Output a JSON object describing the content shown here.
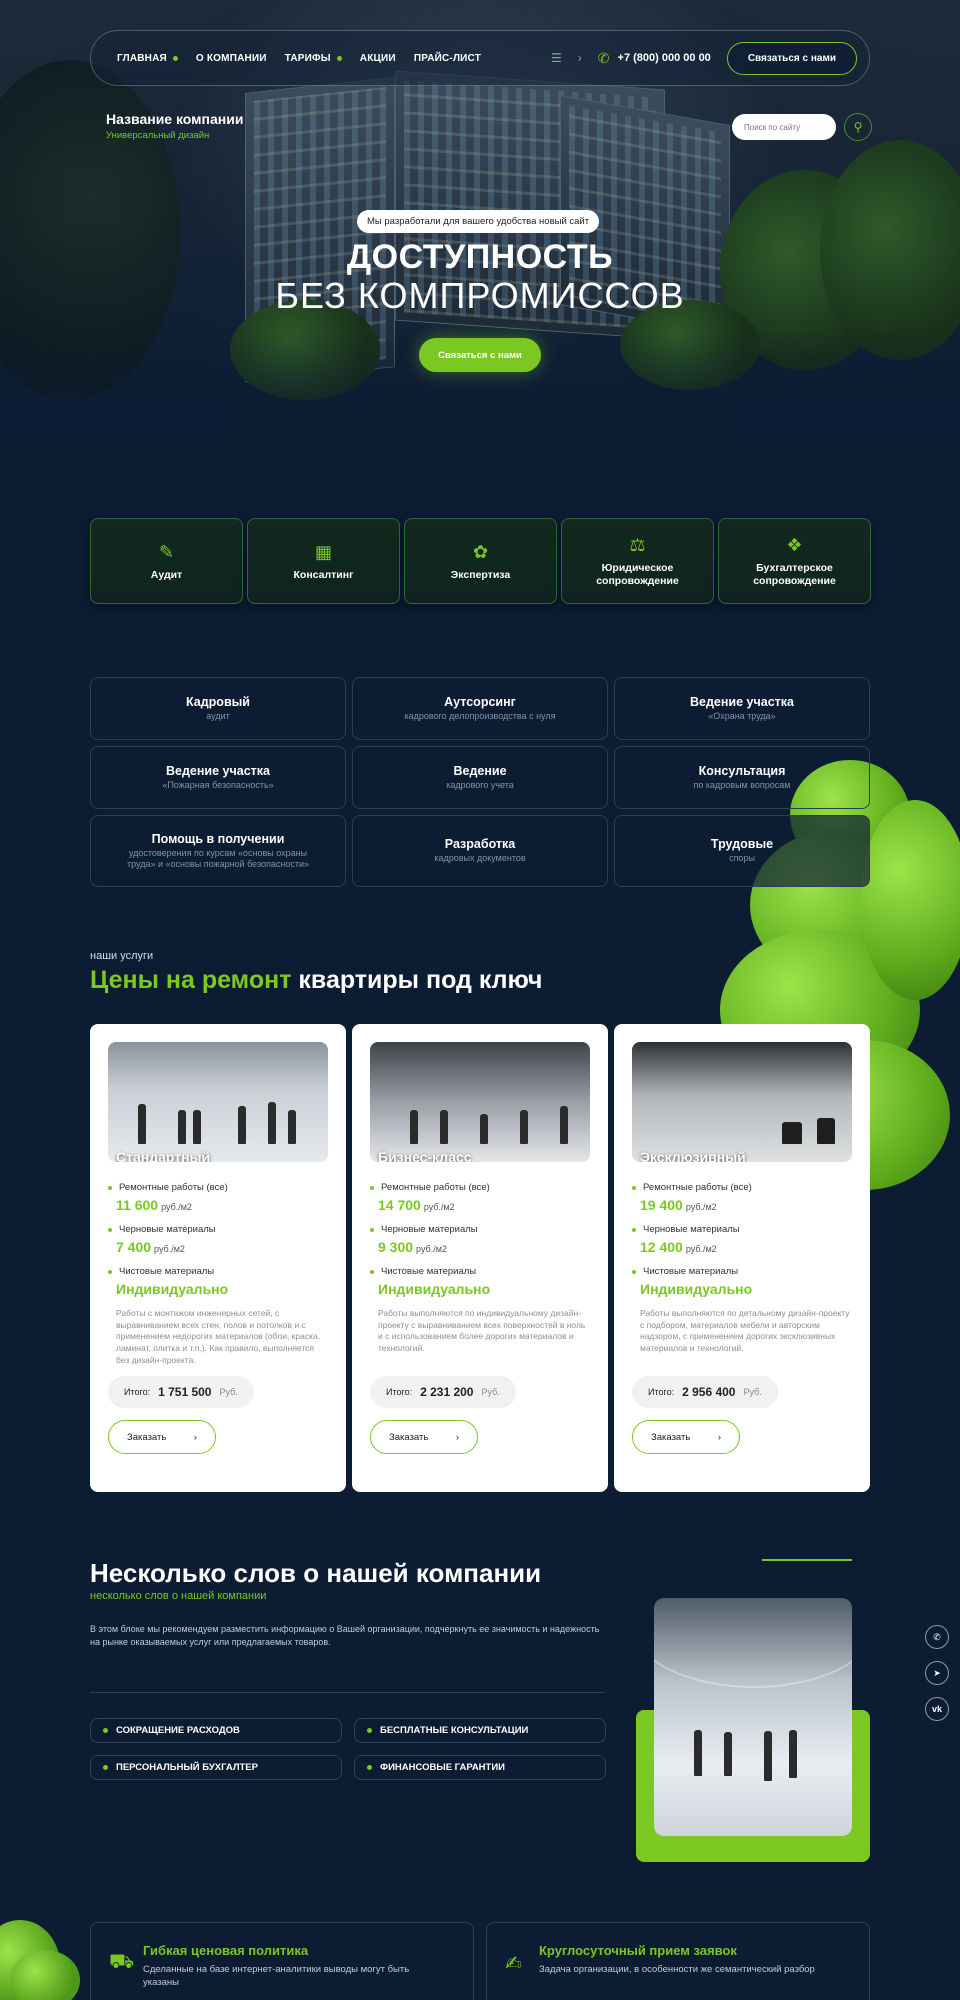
{
  "nav": {
    "items": [
      {
        "label": "ГЛАВНАЯ",
        "dot": true
      },
      {
        "label": "О КОМПАНИИ",
        "dot": false
      },
      {
        "label": "ТАРИФЫ",
        "dot": true
      },
      {
        "label": "АКЦИИ",
        "dot": false
      },
      {
        "label": "ПРАЙС-ЛИСТ",
        "dot": false
      }
    ],
    "phone": "+7 (800) 000 00 00",
    "contact_button": "Связаться с нами"
  },
  "brand": {
    "name": "Название компании",
    "subtitle": "Универсальный дизайн"
  },
  "search": {
    "placeholder": "Поиск по сайту"
  },
  "hero": {
    "badge": "Мы разработали для вашего удобства новый сайт",
    "title_line1": "ДОСТУПНОСТЬ",
    "title_line2": "БЕЗ КОМПРОМИССОВ",
    "cta": "Связаться с нами"
  },
  "features": [
    {
      "label": "Аудит",
      "icon": "clipboard-check-icon"
    },
    {
      "label": "Консалтинг",
      "icon": "briefcase-icon"
    },
    {
      "label": "Экспертиза",
      "icon": "badge-icon"
    },
    {
      "label": "Юридическое сопровождение",
      "icon": "gavel-icon"
    },
    {
      "label": "Бухгалтерское сопровождение",
      "icon": "coins-icon"
    }
  ],
  "services": [
    {
      "title": "Кадровый",
      "sub": "аудит"
    },
    {
      "title": "Аутсорсинг",
      "sub": "кадрового делопроизводства с нуля"
    },
    {
      "title": "Ведение участка",
      "sub": "«Охрана труда»"
    },
    {
      "title": "Ведение участка",
      "sub": "«Пожарная безопасность»"
    },
    {
      "title": "Ведение",
      "sub": "кадрового учета"
    },
    {
      "title": "Консультация",
      "sub": "по кадровым вопросам"
    },
    {
      "title": "Помощь в получении",
      "sub": "удостоверения по курсам «основы охраны труда» и «основы пожарной безопасности»"
    },
    {
      "title": "Разработка",
      "sub": "кадровых документов"
    },
    {
      "title": "Трудовые",
      "sub": "споры"
    }
  ],
  "prices": {
    "kicker": "наши услуги",
    "title_green": "Цены на ремонт",
    "title_white": "квартиры под ключ",
    "plans": [
      {
        "name": "Стандартный",
        "repair_label": "Ремонтные работы (все)",
        "repair_value": "11 600",
        "repair_unit": "руб./м2",
        "rough_label": "Черновые материалы",
        "rough_value": "7 400",
        "rough_unit": "руб./м2",
        "finish_label": "Чистовые материалы",
        "finish_value": "Индивидуально",
        "desc": "Работы с монтажом инженерных сетей, с выравниванием всех стен, полов и потолков и с применением недорогих материалов (обои, краска, ламинат, плитка и т.п.). Как правило, выполняется без дизайн-проекта.",
        "total_label": "Итого:",
        "total_value": "1 751 500",
        "total_unit": "Руб.",
        "order": "Заказать"
      },
      {
        "name": "Бизнес-класс",
        "repair_label": "Ремонтные работы (все)",
        "repair_value": "14 700",
        "repair_unit": "руб./м2",
        "rough_label": "Черновые материалы",
        "rough_value": "9 300",
        "rough_unit": "руб./м2",
        "finish_label": "Чистовые материалы",
        "finish_value": "Индивидуально",
        "desc": "Работы выполняются по индивидуальному дизайн-проекту с выравниванием всех поверхностей в ноль и с использованием более дорогих материалов и технологий.",
        "total_label": "Итого:",
        "total_value": "2 231 200",
        "total_unit": "Руб.",
        "order": "Заказать"
      },
      {
        "name": "Эксклюзивный",
        "repair_label": "Ремонтные работы (все)",
        "repair_value": "19 400",
        "repair_unit": "руб./м2",
        "rough_label": "Черновые материалы",
        "rough_value": "12 400",
        "rough_unit": "руб./м2",
        "finish_label": "Чистовые материалы",
        "finish_value": "Индивидуально",
        "desc": "Работы выполняются по детальному дизайн-проекту с подбором, материалов мебели и авторским надзором, с применением дорогих эксклюзивных материалов и технологий.",
        "total_label": "Итого:",
        "total_value": "2 956 400",
        "total_unit": "Руб.",
        "order": "Заказать"
      }
    ]
  },
  "about": {
    "title": "Несколько слов о нашей компании",
    "subtitle": "несколько слов о нашей компании",
    "text": "В этом блоке мы рекомендуем разместить информацию о Вашей организации, подчеркнуть ее значимость и надежность на рынке оказываемых услуг или предлагаемых товаров.",
    "tags": [
      "СОКРАЩЕНИЕ РАСХОДОВ",
      "БЕСПЛАТНЫЕ КОНСУЛЬТАЦИИ",
      "ПЕРСОНАЛЬНЫЙ БУХГАЛТЕР",
      "ФИНАНСОВЫЕ ГАРАНТИИ"
    ]
  },
  "social": [
    "whatsapp-icon",
    "telegram-icon",
    "vk-icon"
  ],
  "bottom": [
    {
      "title": "Гибкая ценовая политика",
      "text": "Сделанные на базе интернет-аналитики выводы могут быть указаны",
      "icon": "truck-icon"
    },
    {
      "title": "Круглосуточный прием заявок",
      "text": "Задача организации, в особенности же семантический разбор",
      "icon": "hand-coin-icon"
    }
  ],
  "colors": {
    "accent": "#7cc823",
    "background": "#0b1c33"
  }
}
